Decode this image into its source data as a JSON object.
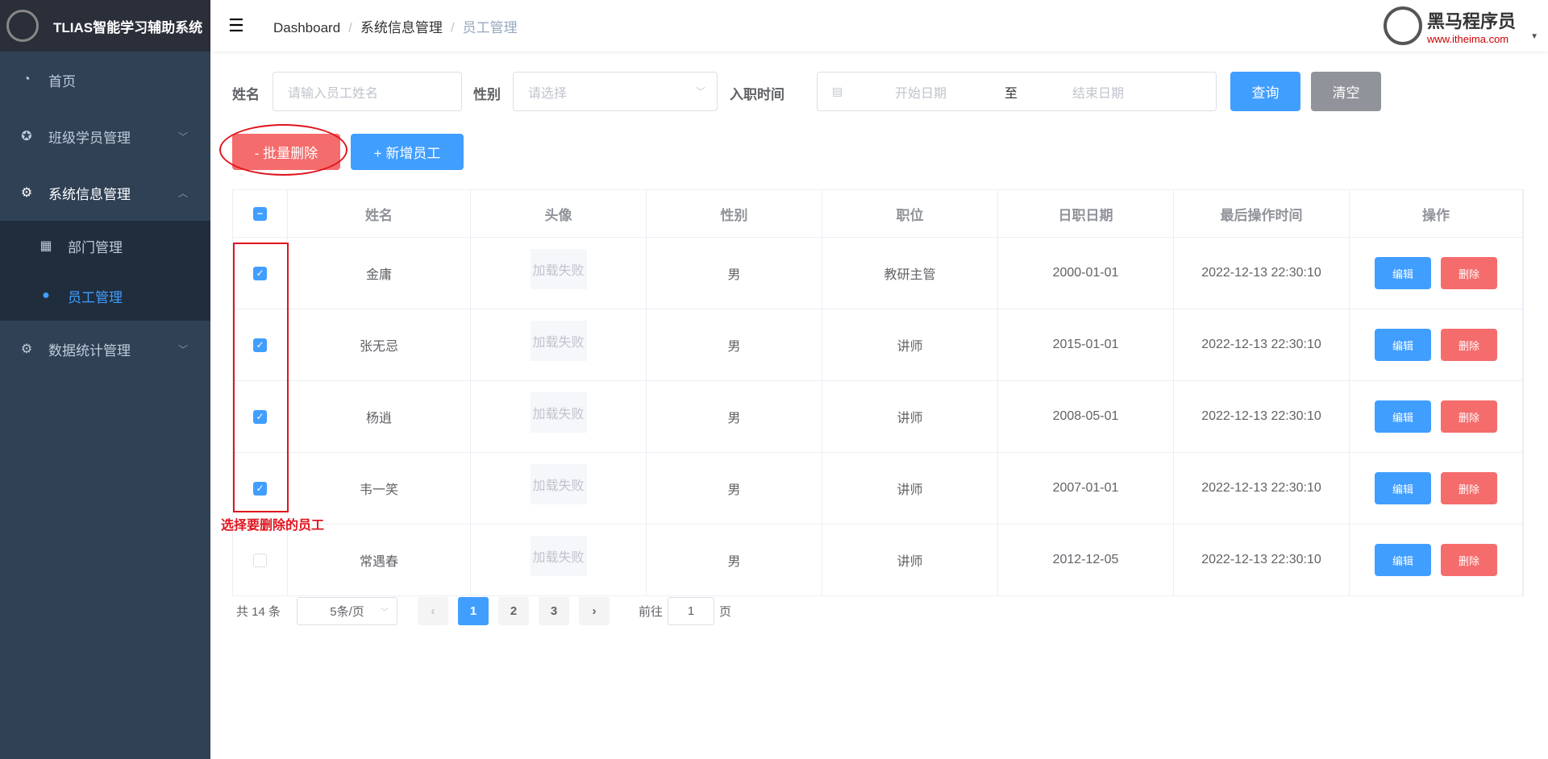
{
  "app": {
    "title": "TLIAS智能学习辅助系统"
  },
  "sidebar": {
    "items": [
      {
        "label": "首页",
        "icon": "dashboard-icon"
      },
      {
        "label": "班级学员管理",
        "icon": "lifebuoy-icon"
      },
      {
        "label": "系统信息管理",
        "icon": "gear-icon"
      },
      {
        "label": "部门管理",
        "icon": "grid-icon"
      },
      {
        "label": "员工管理",
        "icon": "user-icon"
      },
      {
        "label": "数据统计管理",
        "icon": "gear-icon"
      }
    ]
  },
  "header": {
    "breadcrumb": [
      "Dashboard",
      "系统信息管理",
      "员工管理"
    ],
    "brand_name": "黑马程序员",
    "brand_url": "www.itheima.com"
  },
  "search": {
    "name_label": "姓名",
    "name_placeholder": "请输入员工姓名",
    "gender_label": "性别",
    "gender_placeholder": "请选择",
    "date_label": "入职时间",
    "start_placeholder": "开始日期",
    "date_sep": "至",
    "end_placeholder": "结束日期",
    "query": "查询",
    "clear": "清空"
  },
  "actions": {
    "batch_delete": "- 批量删除",
    "add": "+ 新增员工"
  },
  "annotation": {
    "note": "选择要删除的员工"
  },
  "table": {
    "headers": [
      "姓名",
      "头像",
      "性别",
      "职位",
      "日职日期",
      "最后操作时间",
      "操作"
    ],
    "rows": [
      {
        "checked": true,
        "name": "金庸",
        "avatar": "加载失败",
        "gender": "男",
        "job": "教研主管",
        "entry": "2000-01-01",
        "updated": "2022-12-13 22:30:10"
      },
      {
        "checked": true,
        "name": "张无忌",
        "avatar": "加载失败",
        "gender": "男",
        "job": "讲师",
        "entry": "2015-01-01",
        "updated": "2022-12-13 22:30:10"
      },
      {
        "checked": true,
        "name": "杨逍",
        "avatar": "加载失败",
        "gender": "男",
        "job": "讲师",
        "entry": "2008-05-01",
        "updated": "2022-12-13 22:30:10"
      },
      {
        "checked": true,
        "name": "韦一笑",
        "avatar": "加载失败",
        "gender": "男",
        "job": "讲师",
        "entry": "2007-01-01",
        "updated": "2022-12-13 22:30:10"
      },
      {
        "checked": false,
        "name": "常遇春",
        "avatar": "加载失败",
        "gender": "男",
        "job": "讲师",
        "entry": "2012-12-05",
        "updated": "2022-12-13 22:30:10"
      }
    ],
    "edit": "编辑",
    "delete": "删除"
  },
  "pager": {
    "total": "共 14 条",
    "size": "5条/页",
    "pages": [
      "1",
      "2",
      "3"
    ],
    "current": "1",
    "goto": "前往",
    "goto_value": "1",
    "page_suffix": "页"
  },
  "colors": {
    "primary": "#409eff",
    "danger": "#f56c6c",
    "info": "#909399",
    "sidebar": "#304156"
  }
}
